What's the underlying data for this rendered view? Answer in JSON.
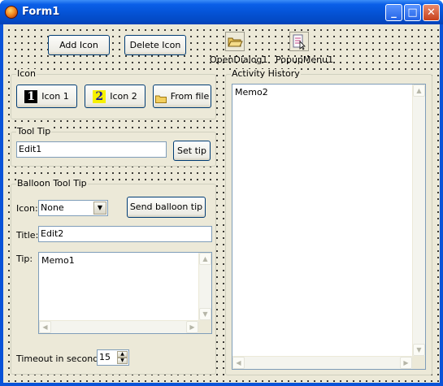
{
  "window": {
    "title": "Form1",
    "minimize_glyph": "_",
    "maximize_glyph": "□",
    "close_glyph": "✕"
  },
  "toolbar": {
    "add_icon_label": "Add Icon",
    "delete_icon_label": "Delete Icon",
    "open_dialog_caption": "OpenDialog1",
    "popup_menu_caption": "PopupMenu1"
  },
  "icon_group": {
    "title": "Icon",
    "icon1_label": "Icon 1",
    "icon1_glyph": "1",
    "icon2_label": "Icon 2",
    "icon2_glyph": "2",
    "from_file_label": "From file"
  },
  "tooltip_group": {
    "title": "Tool Tip",
    "edit_value": "Edit1",
    "set_tip_label": "Set tip"
  },
  "balloon_group": {
    "title": "Balloon Tool Tip",
    "icon_label": "Icon:",
    "icon_selected": "None",
    "send_label": "Send balloon tip",
    "title_label": "Title:",
    "title_value": "Edit2",
    "tip_label": "Tip:",
    "tip_value": "Memo1",
    "timeout_label": "Timeout in seconds:",
    "timeout_value": "15"
  },
  "activity_group": {
    "title": "Activity History",
    "memo_value": "Memo2"
  },
  "colors": {
    "titlebar": "#0554d7",
    "form_bg": "#ece9d8",
    "edit_border": "#7f9db9",
    "button_border": "#003c74"
  },
  "icons": [
    "app-icon",
    "minimize-icon",
    "maximize-icon",
    "close-icon",
    "open-folder-icon",
    "popup-menu-icon",
    "number-one-icon",
    "number-two-icon",
    "folder-icon",
    "dropdown-arrow-icon",
    "spin-up-icon",
    "spin-down-icon",
    "scroll-arrow-icon"
  ]
}
